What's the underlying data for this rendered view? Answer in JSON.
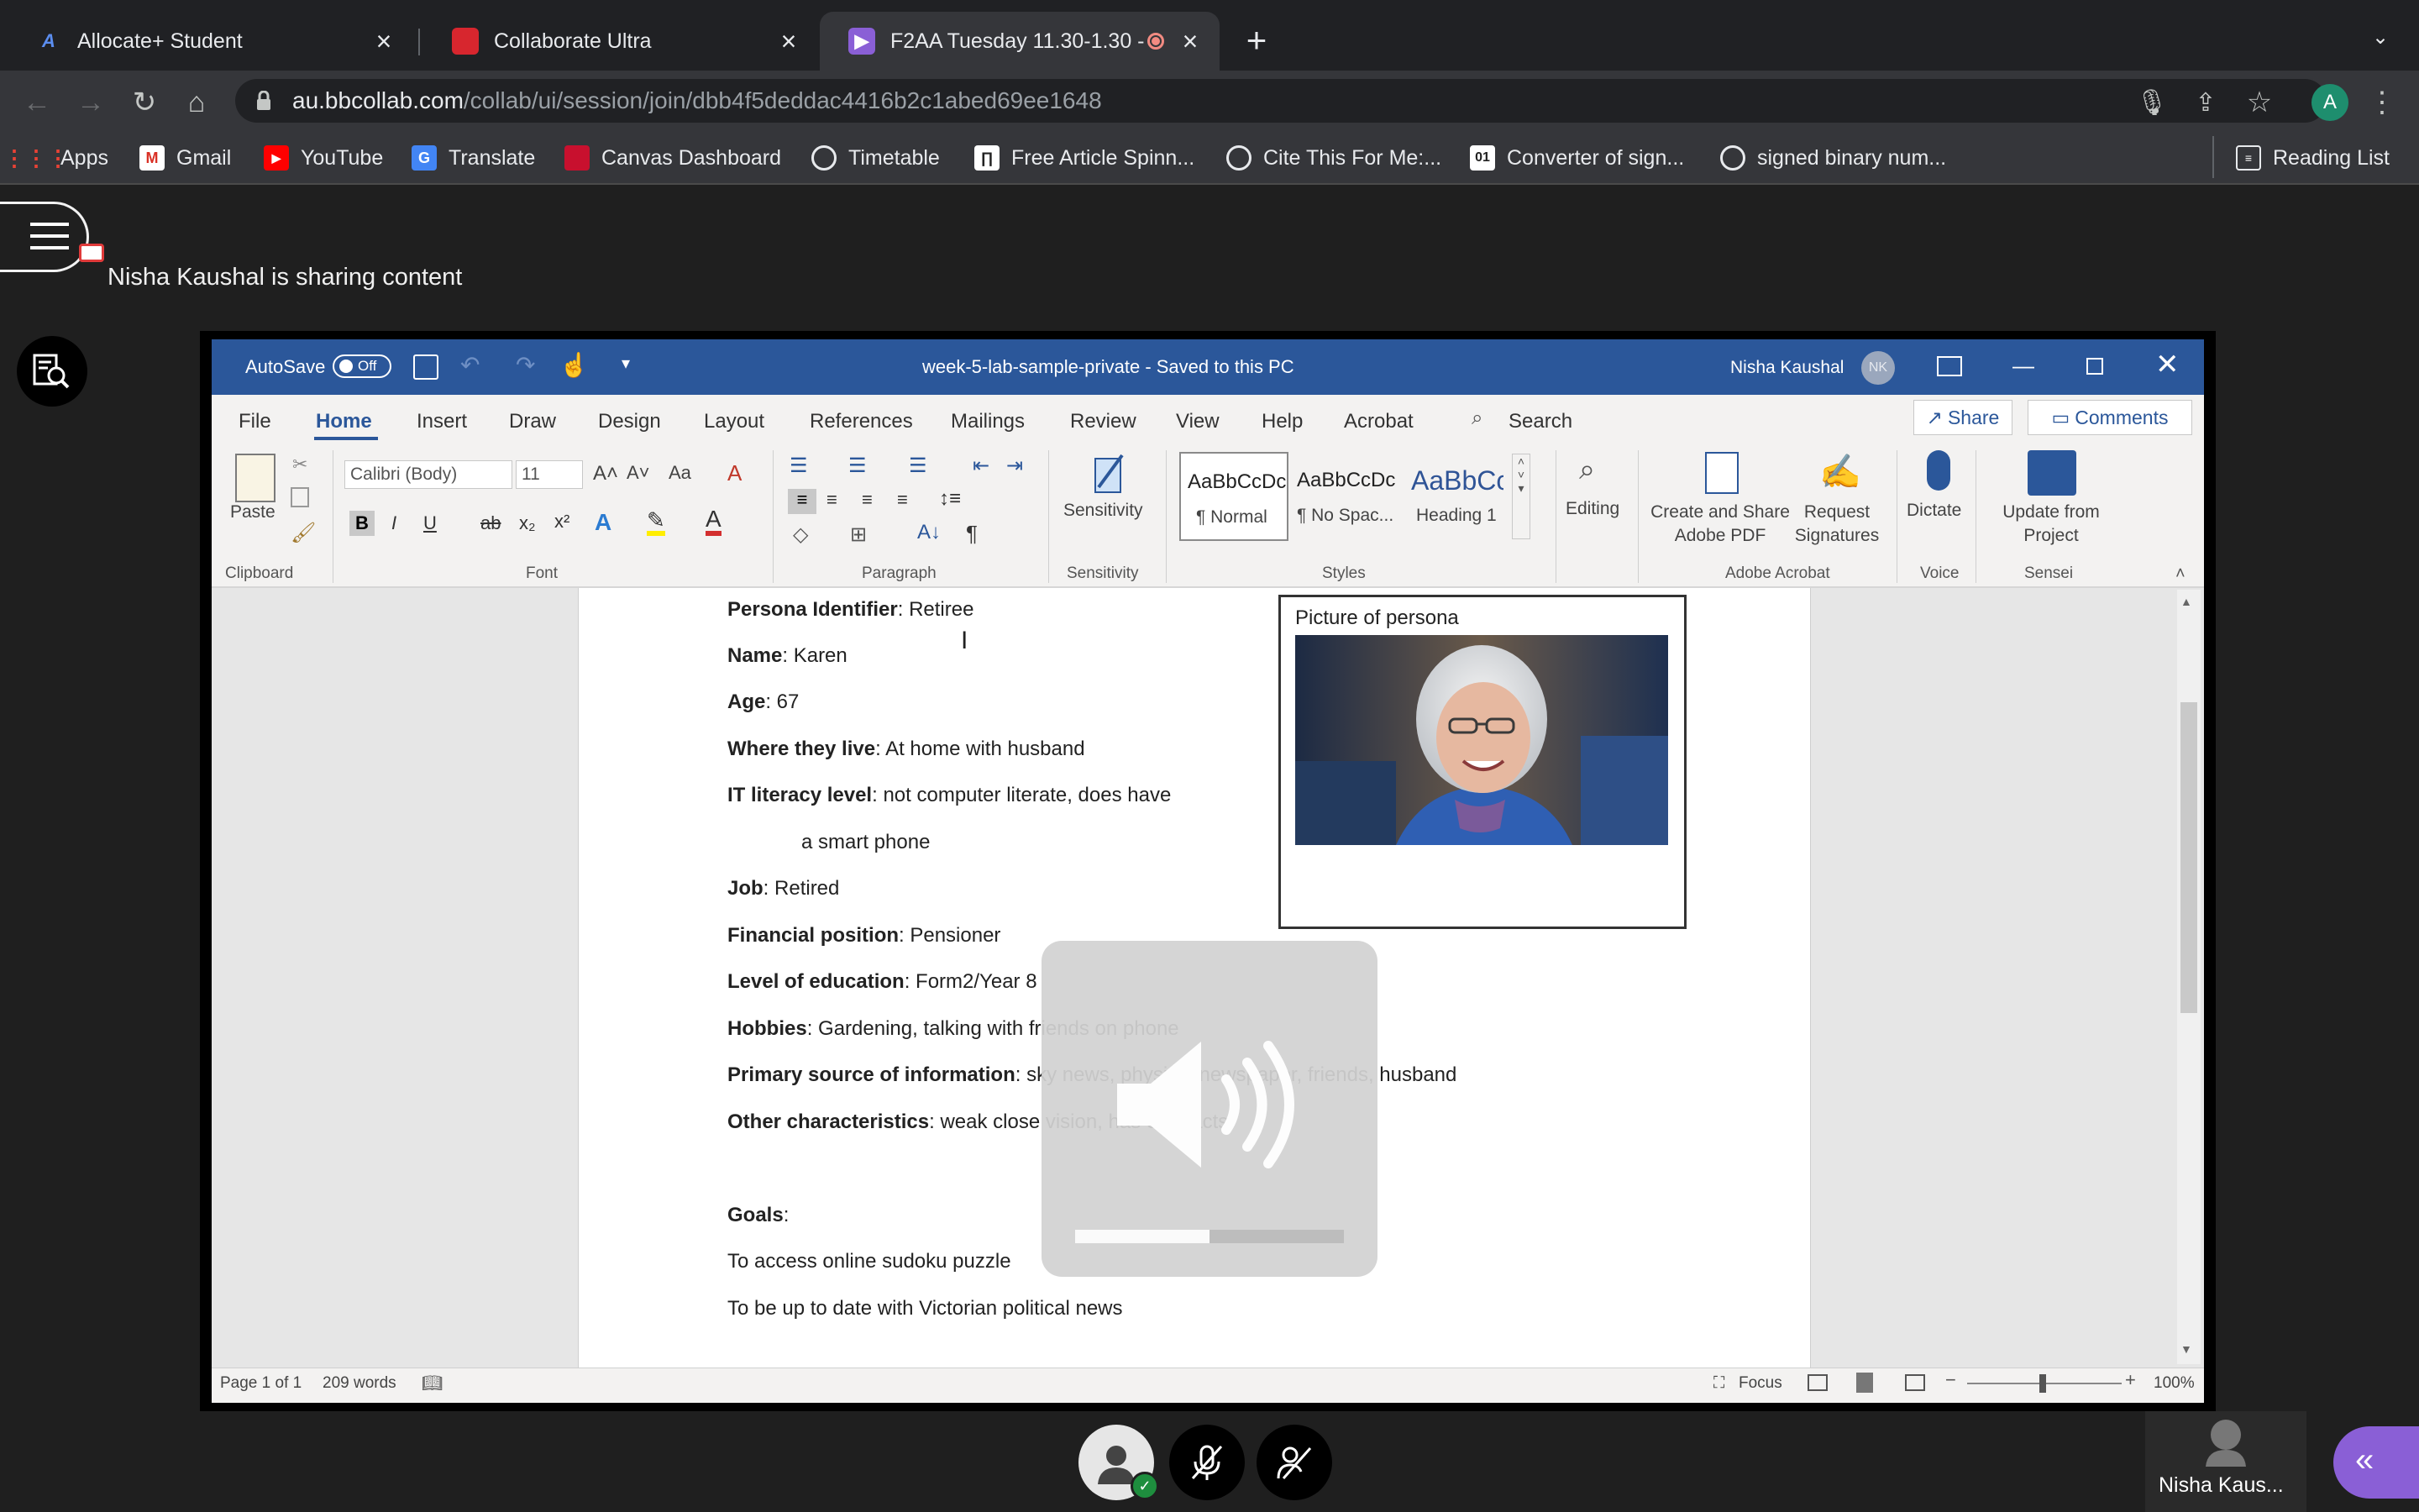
{
  "browser": {
    "tabs": [
      {
        "title": "Allocate+ Student",
        "icon": "allocate-icon",
        "active": false
      },
      {
        "title": "Collaborate Ultra",
        "icon": "collaborate-icon",
        "active": false
      },
      {
        "title": "F2AA Tuesday 11.30-1.30 -",
        "icon": "session-icon",
        "active": true
      }
    ],
    "new_tab": "+",
    "url_host": "au.bbcollab.com",
    "url_path": "/collab/ui/session/join/dbb4f5deddac4416b2c1abed69ee1648",
    "profile_initial": "A",
    "bookmarks": [
      {
        "label": "Apps",
        "icon": "apps-grid-icon"
      },
      {
        "label": "Gmail",
        "icon": "gmail-icon"
      },
      {
        "label": "YouTube",
        "icon": "youtube-icon"
      },
      {
        "label": "Translate",
        "icon": "translate-icon"
      },
      {
        "label": "Canvas Dashboard",
        "icon": "canvas-icon"
      },
      {
        "label": "Timetable",
        "icon": "globe-icon"
      },
      {
        "label": "Free Article Spinn...",
        "icon": "article-icon"
      },
      {
        "label": "Cite This For Me:...",
        "icon": "globe-icon"
      },
      {
        "label": "Converter of sign...",
        "icon": "converter-icon"
      },
      {
        "label": "signed binary num...",
        "icon": "globe-icon"
      }
    ],
    "reading_list": "Reading List"
  },
  "collab": {
    "sharing_text": "Nisha Kaushal is sharing content",
    "participant_name": "Nisha Kaus...",
    "volume_level": 0.5
  },
  "word": {
    "autosave_label": "AutoSave",
    "autosave_state": "Off",
    "doc_title": "week-5-lab-sample-private  -  Saved to this PC",
    "user_name": "Nisha Kaushal",
    "user_initials": "NK",
    "tabs": [
      "File",
      "Home",
      "Insert",
      "Draw",
      "Design",
      "Layout",
      "References",
      "Mailings",
      "Review",
      "View",
      "Help",
      "Acrobat"
    ],
    "search_label": "Search",
    "share_label": "Share",
    "comments_label": "Comments",
    "font_name": "Calibri (Body)",
    "font_size": "11",
    "paste_label": "Paste",
    "sensitivity_label": "Sensitivity",
    "styles": [
      {
        "preview": "AaBbCcDc",
        "name": "¶ Normal"
      },
      {
        "preview": "AaBbCcDc",
        "name": "¶ No Spac..."
      },
      {
        "preview": "AaBbCc",
        "name": "Heading 1"
      }
    ],
    "editing_label": "Editing",
    "create_share_label": "Create and Share Adobe PDF",
    "request_signatures_label": "Request Signatures",
    "dictate_label": "Dictate",
    "update_project_label": "Update from Project",
    "groups": [
      "Clipboard",
      "Font",
      "Paragraph",
      "Sensitivity",
      "Styles",
      "Adobe Acrobat",
      "Voice",
      "Sensei"
    ],
    "status_page": "Page 1 of 1",
    "status_words": "209 words",
    "status_focus": "Focus",
    "zoom": "100%",
    "picture_caption": "Picture of persona",
    "fields": [
      {
        "label": "Persona Identifier",
        "value": ": Retiree"
      },
      {
        "label": "Name",
        "value": ": Karen"
      },
      {
        "label": "Age",
        "value": ": 67"
      },
      {
        "label": "Where they live",
        "value": ": At home with husband"
      },
      {
        "label": "IT literacy level",
        "value": ": not computer literate, does have"
      },
      {
        "label": "",
        "value": "a smart phone"
      },
      {
        "label": "Job",
        "value": ": Retired"
      },
      {
        "label": "Financial position",
        "value": ": Pensioner"
      },
      {
        "label": "Level of education",
        "value": ": Form2/Year 8"
      },
      {
        "label": "Hobbies",
        "value": ": Gardening, talking with friends on phone"
      },
      {
        "label": "Primary source of information",
        "value": ": sky news, physical newspaper, friends, husband"
      },
      {
        "label": "Other characteristics",
        "value": ": weak close vision, has cataracts"
      },
      {
        "label": "Goals",
        "value": ":"
      },
      {
        "label": "",
        "value": "To access online sudoku puzzle"
      },
      {
        "label": "",
        "value": "To be up to date with Victorian political news"
      }
    ]
  }
}
